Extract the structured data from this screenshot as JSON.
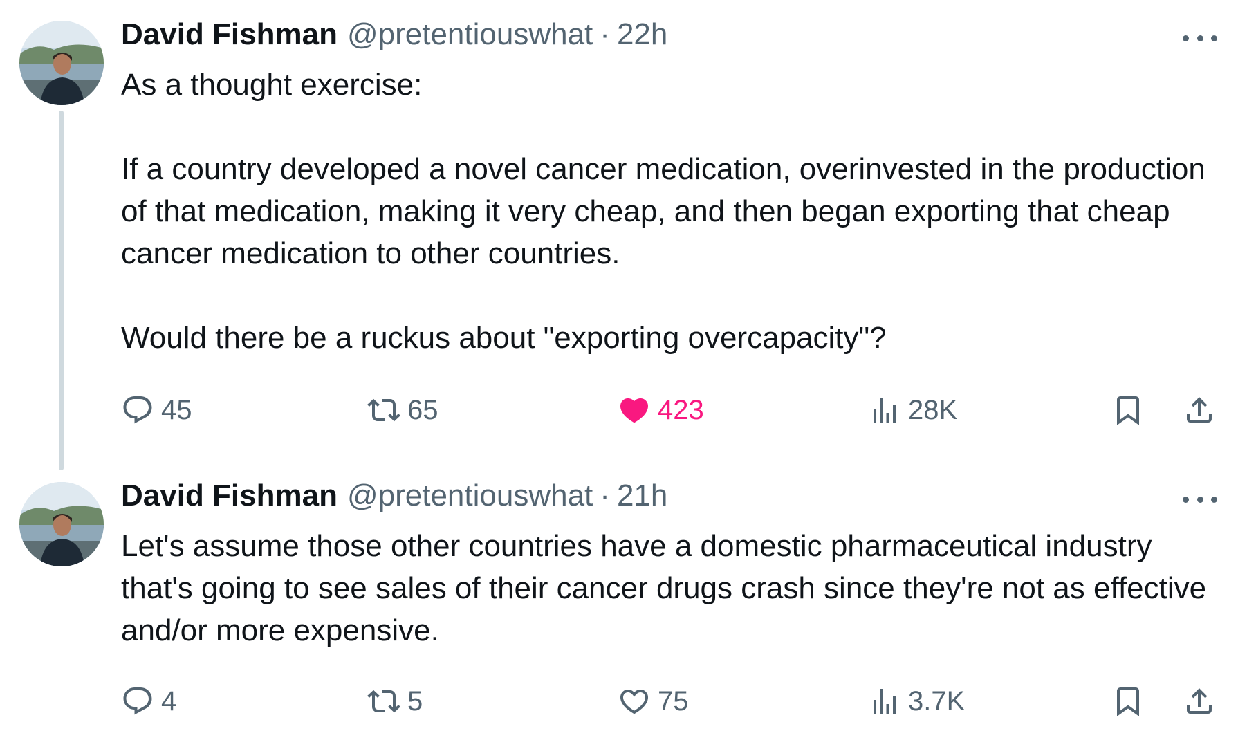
{
  "colors": {
    "text": "#0f1419",
    "secondary": "#536471",
    "like": "#f91880",
    "thread_line": "#cfd9de"
  },
  "tweets": [
    {
      "author_name": "David Fishman",
      "handle": "@pretentiouswhat",
      "separator": "·",
      "time": "22h",
      "text": "As a thought exercise:\n\nIf a country developed a novel cancer medication, overinvested in the production of that medication, making it very cheap, and then began exporting that cheap cancer medication to other countries.\n\nWould there be a ruckus about \"exporting overcapacity\"?",
      "replies": "45",
      "reposts": "65",
      "likes": "423",
      "liked": true,
      "views": "28K"
    },
    {
      "author_name": "David Fishman",
      "handle": "@pretentiouswhat",
      "separator": "·",
      "time": "21h",
      "text": "Let's assume those other countries have a domestic pharmaceutical industry that's going to see sales of their cancer drugs crash since they're not as effective and/or more expensive.",
      "replies": "4",
      "reposts": "5",
      "likes": "75",
      "liked": false,
      "views": "3.7K"
    }
  ]
}
